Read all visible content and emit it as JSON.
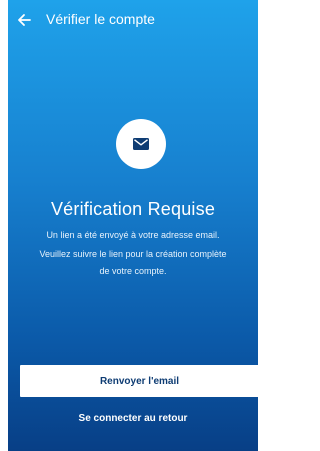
{
  "header": {
    "title": "Vérifier le compte",
    "back_icon": "arrow-left-icon"
  },
  "main": {
    "icon": "mail-envelope-icon",
    "title": "Vérification Requise",
    "description_lines": [
      "Un lien a été envoyé à votre adresse email.",
      "Veuillez suivre le lien pour la création complète",
      "de votre compte."
    ]
  },
  "actions": {
    "resend_label": "Renvoyer l'email",
    "back_login_label": "Se connecter au retour"
  },
  "colors": {
    "gradient_top": "#1fa2ea",
    "gradient_bottom": "#083f86",
    "button_text": "#0e3c73"
  }
}
